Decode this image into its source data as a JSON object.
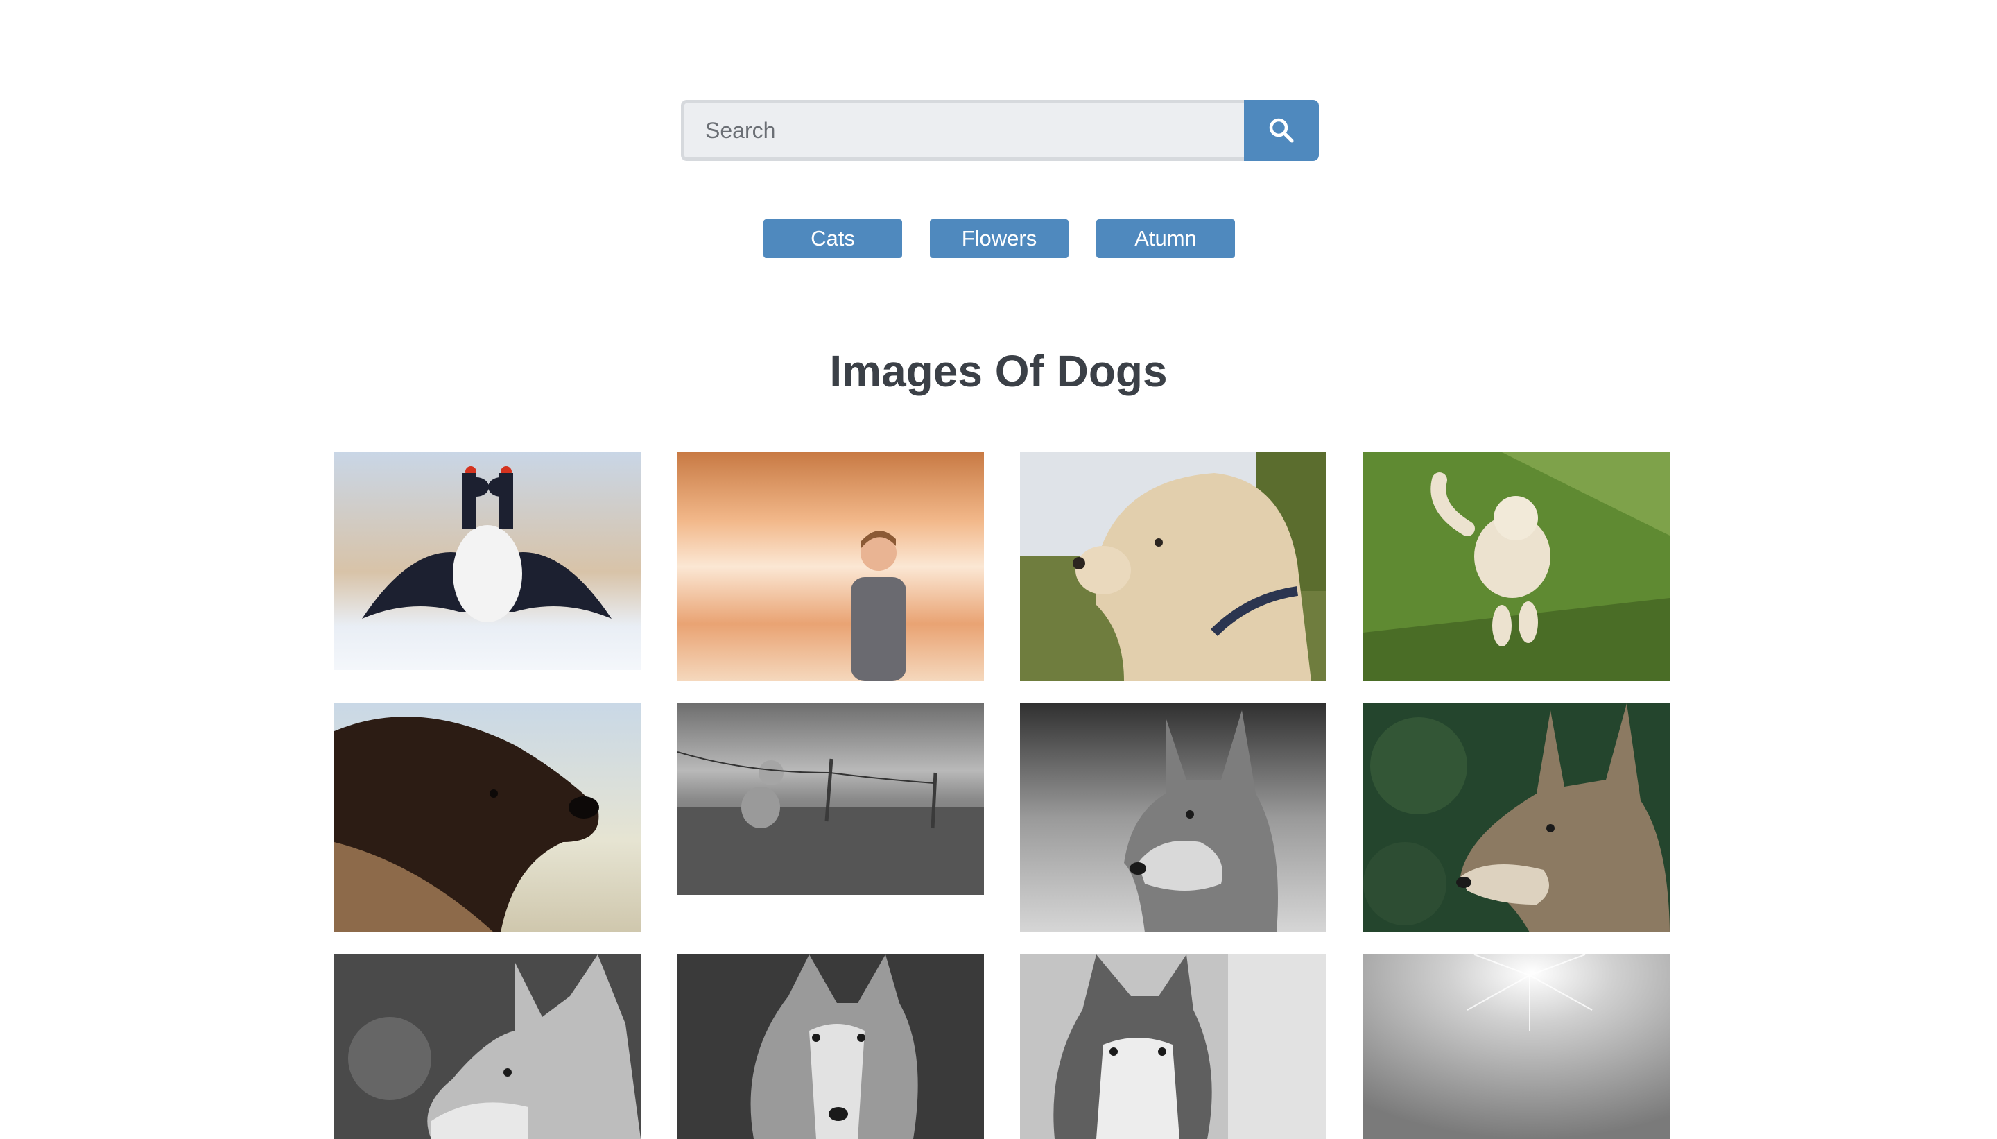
{
  "search": {
    "placeholder": "Search",
    "value": ""
  },
  "categories": [
    "Cats",
    "Flowers",
    "Atumn"
  ],
  "heading": "Images Of Dogs",
  "colors": {
    "accent": "#4f89be",
    "heading": "#3b4047",
    "input_bg": "#eceef1"
  },
  "icons": {
    "search": "magnifier-icon"
  }
}
